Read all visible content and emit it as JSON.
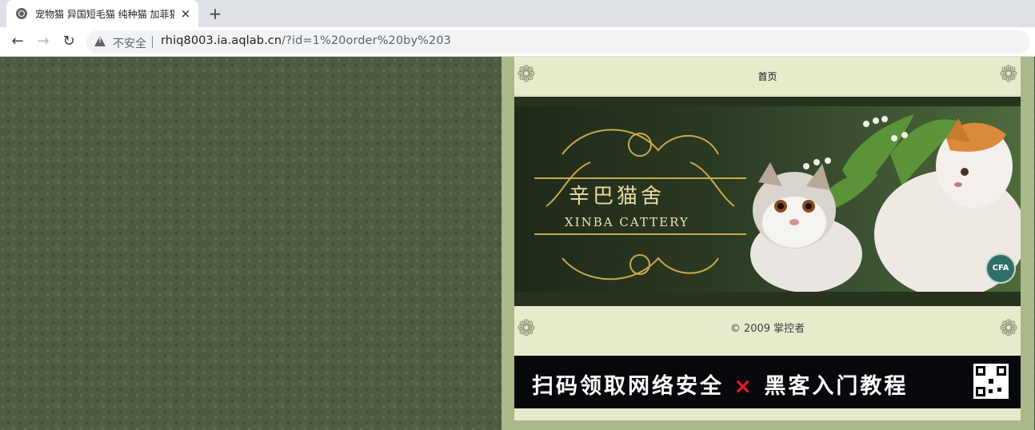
{
  "browser": {
    "tab_title": "宠物猫 异国短毛猫 纯种猫 加菲猫",
    "tab_close_icon": "×",
    "new_tab_icon": "+",
    "security_label": "不安全",
    "url_host": "rhiq8003.ia.aqlab.cn",
    "url_rest": "/?id=1%20order%20by%203"
  },
  "site": {
    "nav_home": "首页",
    "banner_title": "辛巴猫舍",
    "banner_subtitle": "XINBA CATTERY",
    "badge": "CFA",
    "copyright": "© 2009 掌控者",
    "ad_text_left": "扫码领取网络安全",
    "ad_text_x": "×",
    "ad_text_right": "黑客入门教程"
  },
  "colors": {
    "page_background": "#4f5b41",
    "content_background": "#e7ebcc",
    "sidebar_green": "#a9b98a",
    "ad_accent": "#e51c23"
  }
}
